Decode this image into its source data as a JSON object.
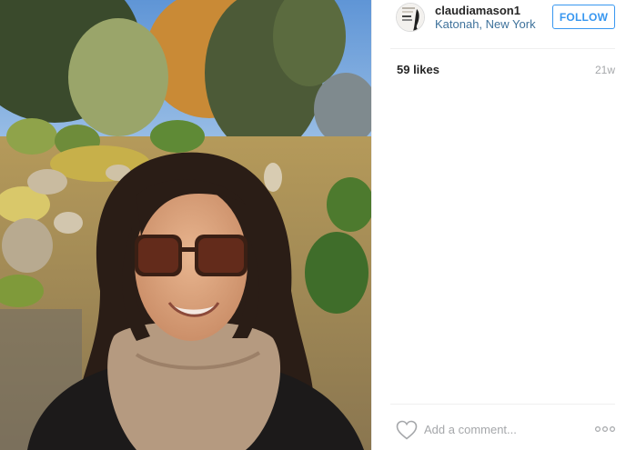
{
  "post": {
    "header": {
      "username": "claudiamason1",
      "location": "Katonah, New York",
      "follow_label": "FOLLOW",
      "avatar_icon": "book-cover-avatar"
    },
    "likes": "59 likes",
    "age": "21w",
    "footer": {
      "like_icon": "heart-outline-icon",
      "comment_placeholder": "Add a comment...",
      "more_icon": "more-options-icon"
    }
  },
  "colors": {
    "link": "#3f729b",
    "follow_accent": "#3897f0",
    "muted": "#a5a7aa",
    "divider": "#efefef"
  }
}
